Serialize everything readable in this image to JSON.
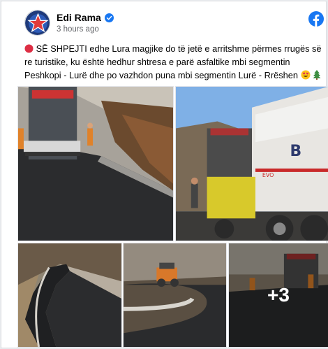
{
  "post": {
    "author": "Edi Rama",
    "time": "3 hours ago",
    "text_main": "SË SHPEJTI edhe Lura magjike do të jetë e arritshme përmes rrugës së re turistike, ku është hedhur shtresa e parë asfaltike mbi segmentin Peshkopi - Lurë dhe po vazhdon puna mbi segmentin Lurë - Rrëshen",
    "leading_icon": "red-circle-emoji",
    "trailing_icons": [
      "heart-eyes-emoji",
      "evergreen-tree-emoji"
    ],
    "more_photos": "+3"
  },
  "photos": [
    {
      "name": "photo-paver-road",
      "alt": "paver machine on fresh asphalt"
    },
    {
      "name": "photo-truck-paver",
      "alt": "dump truck feeding paver"
    },
    {
      "name": "photo-winding-road",
      "alt": "winding asphalt road"
    },
    {
      "name": "photo-roller-curve",
      "alt": "roller on curved road"
    },
    {
      "name": "photo-more",
      "alt": "paving crew"
    }
  ],
  "truck_sign": "B",
  "truck_brand": "EVO",
  "colors": {
    "facebook_blue": "#1877f2",
    "verified_blue": "#1877f2",
    "text": "#050505",
    "muted": "#65676b"
  }
}
